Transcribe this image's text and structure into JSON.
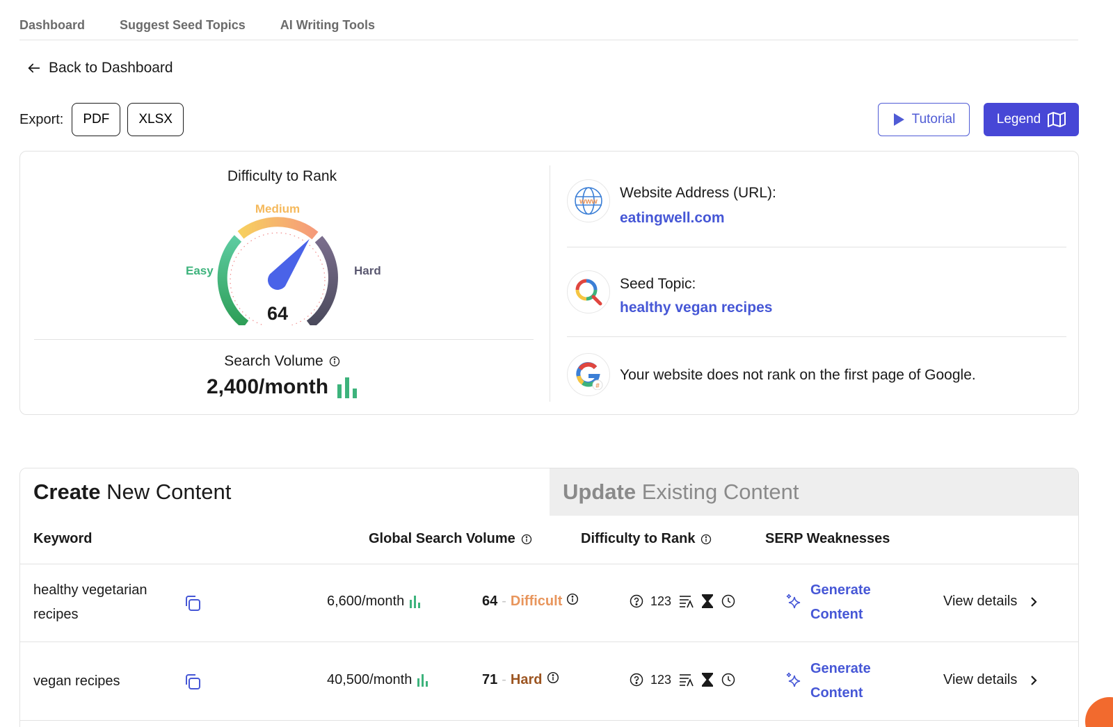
{
  "nav": {
    "items": [
      {
        "label": "Dashboard"
      },
      {
        "label": "Suggest Seed Topics"
      },
      {
        "label": "AI Writing Tools"
      }
    ]
  },
  "back": {
    "label": "Back to Dashboard",
    "icon": "arrow-left-icon"
  },
  "export": {
    "label": "Export:",
    "pdf": "PDF",
    "xlsx": "XLSX"
  },
  "toolbar": {
    "tutorial": "Tutorial",
    "legend": "Legend"
  },
  "summary": {
    "difficulty_title": "Difficulty to Rank",
    "gauge": {
      "easy": "Easy",
      "medium": "Medium",
      "hard": "Hard",
      "value": "64",
      "score": 64,
      "max": 100
    },
    "search_volume_label": "Search Volume",
    "search_volume_value": "2,400/month",
    "website_label": "Website Address (URL):",
    "website_value": "eatingwell.com",
    "seed_label": "Seed Topic:",
    "seed_value": "healthy vegan recipes",
    "google_note": "Your website does not rank on the first page of Google."
  },
  "tabs": {
    "create_bold": "Create",
    "create_rest": "New Content",
    "update_bold": "Update",
    "update_rest": "Existing Content"
  },
  "table": {
    "headers": {
      "keyword": "Keyword",
      "volume": "Global Search Volume",
      "difficulty": "Difficulty to Rank",
      "serp": "SERP Weaknesses"
    },
    "rows": [
      {
        "keyword": "healthy vegetarian recipes",
        "volume": "6,600/month",
        "difficulty_num": "64",
        "difficulty_label": "Difficult",
        "difficulty_color": "#e8955c",
        "serp_count": "123",
        "action": "Generate Content",
        "details": "View details"
      },
      {
        "keyword": "vegan recipes",
        "volume": "40,500/month",
        "difficulty_num": "71",
        "difficulty_label": "Hard",
        "difficulty_color": "#9c5521",
        "serp_count": "123",
        "action": "Generate Content",
        "details": "View details"
      }
    ]
  },
  "colors": {
    "accent": "#4747d6",
    "link": "#4657d6",
    "easy": "#3db37c",
    "medium": "#f5b95c",
    "hard": "#5a5870"
  }
}
